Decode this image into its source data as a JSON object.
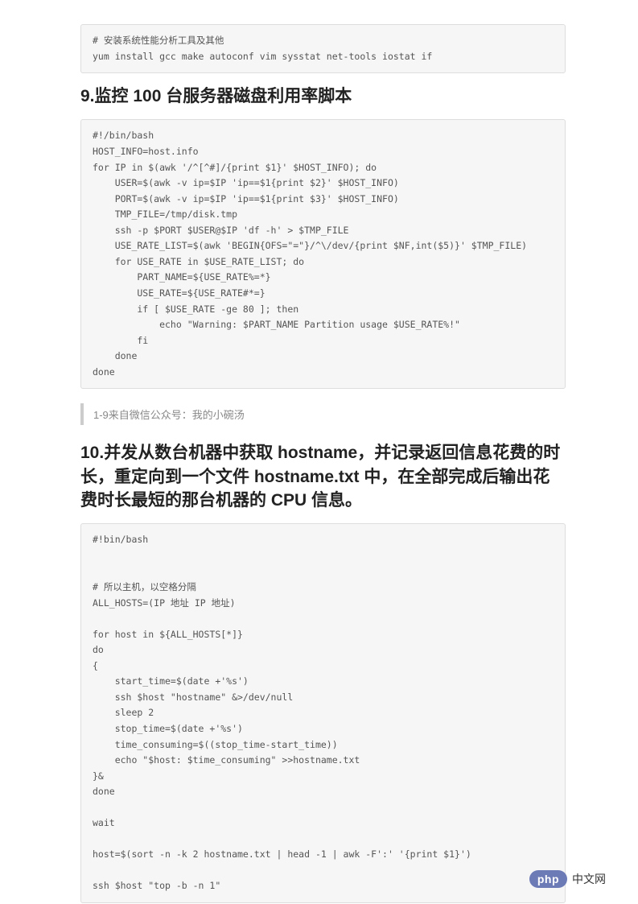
{
  "code1": "# 安装系统性能分析工具及其他\nyum install gcc make autoconf vim sysstat net-tools iostat if",
  "heading9": "9.监控 100 台服务器磁盘利用率脚本",
  "code2": "#!/bin/bash\nHOST_INFO=host.info\nfor IP in $(awk '/^[^#]/{print $1}' $HOST_INFO); do\n    USER=$(awk -v ip=$IP 'ip==$1{print $2}' $HOST_INFO)\n    PORT=$(awk -v ip=$IP 'ip==$1{print $3}' $HOST_INFO)\n    TMP_FILE=/tmp/disk.tmp\n    ssh -p $PORT $USER@$IP 'df -h' > $TMP_FILE\n    USE_RATE_LIST=$(awk 'BEGIN{OFS=\"=\"}/^\\/dev/{print $NF,int($5)}' $TMP_FILE)\n    for USE_RATE in $USE_RATE_LIST; do\n        PART_NAME=${USE_RATE%=*}\n        USE_RATE=${USE_RATE#*=}\n        if [ $USE_RATE -ge 80 ]; then\n            echo \"Warning: $PART_NAME Partition usage $USE_RATE%!\"\n        fi\n    done\ndone",
  "quote": "1-9来自微信公众号：我的小碗汤",
  "heading10": "10.并发从数台机器中获取 hostname，并记录返回信息花费的时长，重定向到一个文件 hostname.txt 中，在全部完成后输出花费时长最短的那台机器的 CPU 信息。",
  "code3": "#!bin/bash\n\n\n# 所以主机，以空格分隔\nALL_HOSTS=(IP 地址 IP 地址)\n\nfor host in ${ALL_HOSTS[*]}\ndo\n{\n    start_time=$(date +'%s')\n    ssh $host \"hostname\" &>/dev/null\n    sleep 2\n    stop_time=$(date +'%s')\n    time_consuming=$((stop_time-start_time))\n    echo \"$host: $time_consuming\" >>hostname.txt\n}&\ndone\n\nwait\n\nhost=$(sort -n -k 2 hostname.txt | head -1 | awk -F':' '{print $1}')\n\nssh $host \"top -b -n 1\"",
  "footer": {
    "badge": "php",
    "text": "中文网"
  }
}
